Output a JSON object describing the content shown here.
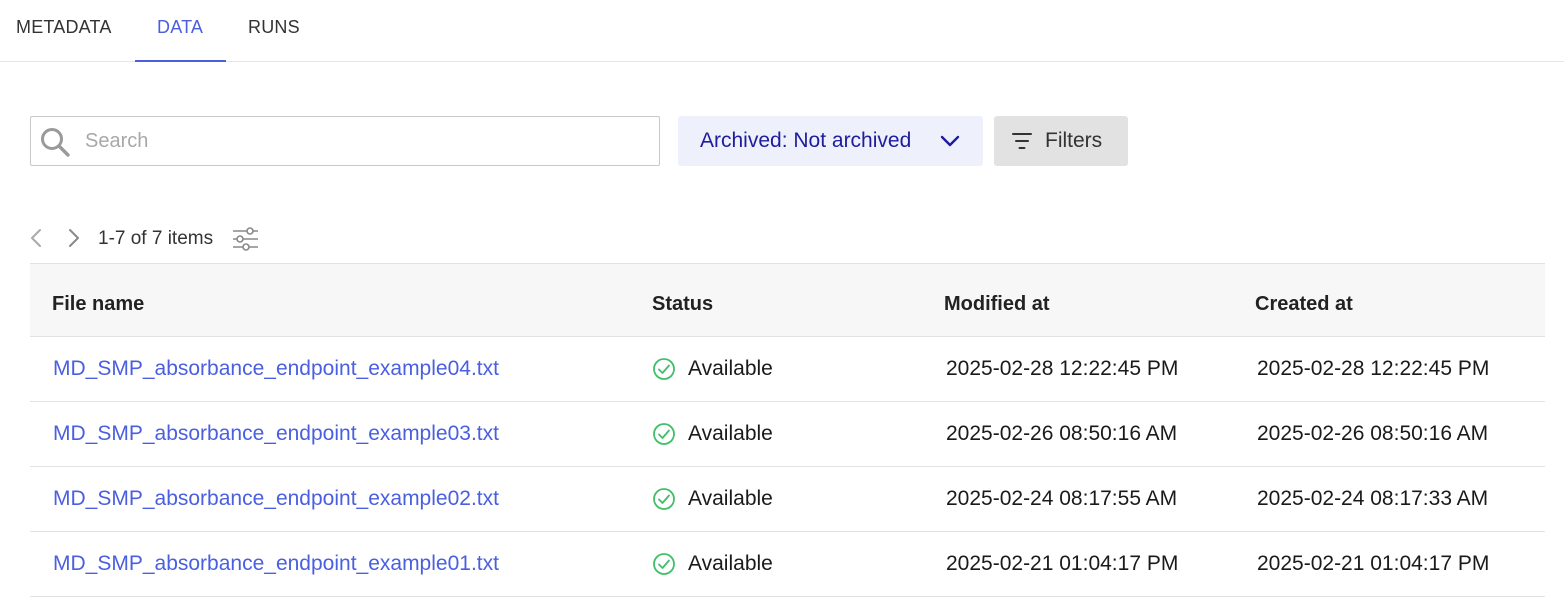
{
  "tabs": [
    {
      "label": "METADATA"
    },
    {
      "label": "DATA"
    },
    {
      "label": "RUNS"
    }
  ],
  "active_tab": "DATA",
  "search": {
    "placeholder": "Search",
    "value": ""
  },
  "archived_filter": {
    "label": "Archived: Not archived"
  },
  "filters_button": {
    "label": "Filters"
  },
  "pagination": {
    "text": "1-7 of 7 items"
  },
  "table": {
    "columns": [
      "File name",
      "Status",
      "Modified at",
      "Created at"
    ],
    "rows": [
      {
        "file_name": "MD_SMP_absorbance_endpoint_example04.txt",
        "status": "Available",
        "modified_at": "2025-02-28 12:22:45 PM",
        "created_at": "2025-02-28 12:22:45 PM"
      },
      {
        "file_name": "MD_SMP_absorbance_endpoint_example03.txt",
        "status": "Available",
        "modified_at": "2025-02-26 08:50:16 AM",
        "created_at": "2025-02-26 08:50:16 AM"
      },
      {
        "file_name": "MD_SMP_absorbance_endpoint_example02.txt",
        "status": "Available",
        "modified_at": "2025-02-24 08:17:55 AM",
        "created_at": "2025-02-24 08:17:33 AM"
      },
      {
        "file_name": "MD_SMP_absorbance_endpoint_example01.txt",
        "status": "Available",
        "modified_at": "2025-02-21 01:04:17 PM",
        "created_at": "2025-02-21 01:04:17 PM"
      }
    ]
  },
  "colors": {
    "accent": "#4a5fe0",
    "archived_bg": "#eef0fb",
    "archived_text": "#1d1d9e",
    "status_ok": "#3fbf6a"
  },
  "icons": {
    "search": "search-icon",
    "archived_dropdown": "chevron-down-icon",
    "filters": "filter-icon",
    "pager_prev": "chevron-left-icon",
    "pager_next": "chevron-right-icon",
    "column_settings": "sliders-icon",
    "status": "check-circle-icon"
  }
}
